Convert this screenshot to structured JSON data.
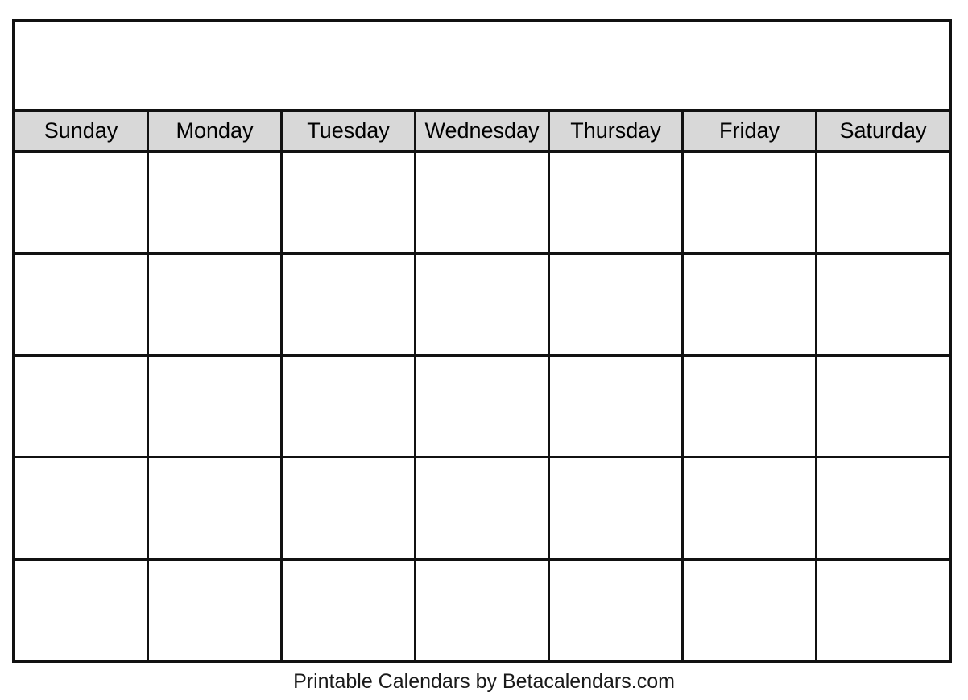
{
  "document": {
    "type": "printable-blank-calendar",
    "title_line": "",
    "background_color": "#ffffff",
    "border_color": "#111111",
    "weekday_header_background": "#d8d8d8",
    "text_color": "#000000"
  },
  "calendar": {
    "weekday_headers": [
      {
        "label": "Sunday"
      },
      {
        "label": "Monday"
      },
      {
        "label": "Tuesday"
      },
      {
        "label": "Wednesday"
      },
      {
        "label": "Thursday"
      },
      {
        "label": "Friday"
      },
      {
        "label": "Saturday"
      }
    ],
    "weeks": [
      {
        "days": [
          {
            "number": ""
          },
          {
            "number": ""
          },
          {
            "number": ""
          },
          {
            "number": ""
          },
          {
            "number": ""
          },
          {
            "number": ""
          },
          {
            "number": ""
          }
        ]
      },
      {
        "days": [
          {
            "number": ""
          },
          {
            "number": ""
          },
          {
            "number": ""
          },
          {
            "number": ""
          },
          {
            "number": ""
          },
          {
            "number": ""
          },
          {
            "number": ""
          }
        ]
      },
      {
        "days": [
          {
            "number": ""
          },
          {
            "number": ""
          },
          {
            "number": ""
          },
          {
            "number": ""
          },
          {
            "number": ""
          },
          {
            "number": ""
          },
          {
            "number": ""
          }
        ]
      },
      {
        "days": [
          {
            "number": ""
          },
          {
            "number": ""
          },
          {
            "number": ""
          },
          {
            "number": ""
          },
          {
            "number": ""
          },
          {
            "number": ""
          },
          {
            "number": ""
          }
        ]
      },
      {
        "days": [
          {
            "number": ""
          },
          {
            "number": ""
          },
          {
            "number": ""
          },
          {
            "number": ""
          },
          {
            "number": ""
          },
          {
            "number": ""
          },
          {
            "number": ""
          }
        ]
      }
    ]
  },
  "footer": {
    "credit": "Printable Calendars by Betacalendars.com"
  }
}
